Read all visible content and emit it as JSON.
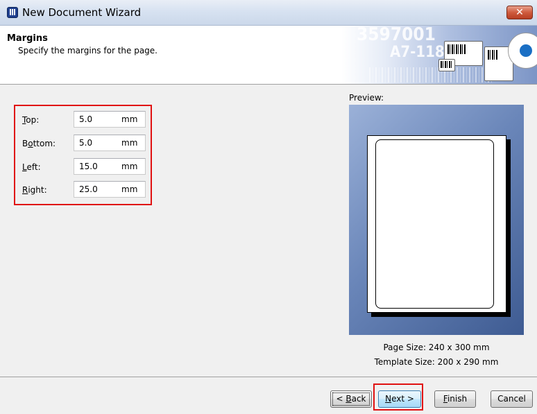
{
  "window": {
    "title": "New Document Wizard",
    "close_glyph": "✕"
  },
  "header": {
    "title": "Margins",
    "subtitle": "Specify the margins for the page.",
    "banner_text_1": "3597001",
    "banner_text_2": "A7-118"
  },
  "fields": [
    {
      "label": "Top",
      "accesskey": "T",
      "rest": "op:",
      "value": "5.0",
      "unit": "mm"
    },
    {
      "label": "Bottom",
      "accesskey": "o",
      "prefix": "B",
      "rest": "ttom:",
      "value": "5.0",
      "unit": "mm"
    },
    {
      "label": "Left",
      "accesskey": "L",
      "rest": "eft:",
      "value": "15.0",
      "unit": "mm"
    },
    {
      "label": "Right",
      "accesskey": "R",
      "rest": "ight:",
      "value": "25.0",
      "unit": "mm"
    }
  ],
  "preview": {
    "label": "Preview:",
    "page_size": "Page Size:  240 x 300 mm",
    "template_size": "Template Size:  200 x 290 mm"
  },
  "buttons": {
    "back": {
      "prefix": "< ",
      "accesskey": "B",
      "rest": "ack"
    },
    "next": {
      "accesskey": "N",
      "rest": "ext >"
    },
    "finish": {
      "accesskey": "F",
      "rest": "inish"
    },
    "cancel": "Cancel"
  },
  "colors": {
    "highlight": "#e01010",
    "preview_bg": "#6a86b9"
  }
}
